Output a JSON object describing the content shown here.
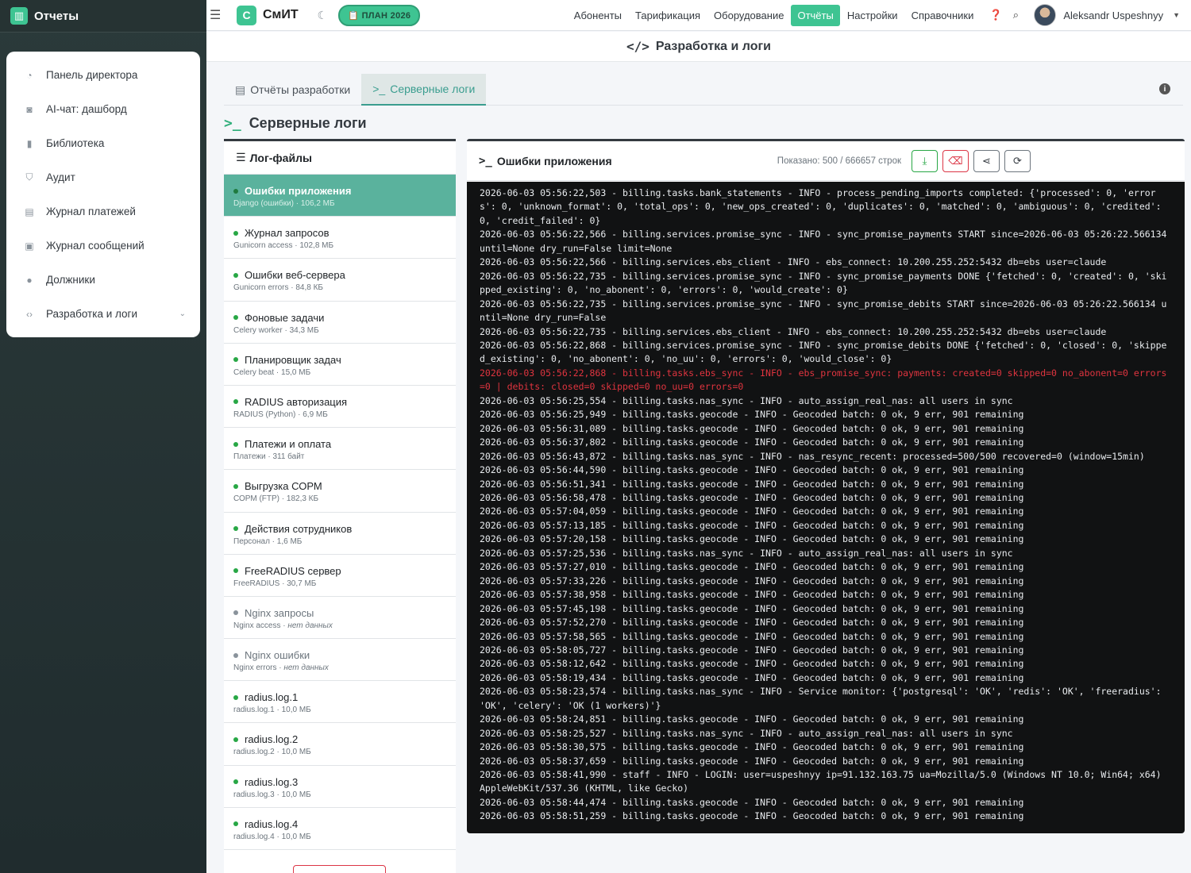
{
  "sidebar": {
    "brand": "Отчеты",
    "items": [
      {
        "label": "Панель директора",
        "icon": "gauge-icon"
      },
      {
        "label": "AI-чат: дашборд",
        "icon": "robot-icon"
      },
      {
        "label": "Библиотека",
        "icon": "book-icon"
      },
      {
        "label": "Аудит",
        "icon": "shield-icon"
      },
      {
        "label": "Журнал платежей",
        "icon": "file-invoice-icon"
      },
      {
        "label": "Журнал сообщений",
        "icon": "message-icon"
      },
      {
        "label": "Должники",
        "icon": "users-icon"
      },
      {
        "label": "Разработка и логи",
        "icon": "code-icon"
      }
    ]
  },
  "topnav": {
    "logo_letter": "С",
    "logo_text": "СмИТ",
    "plan_badge": "📋 ПЛАН 2026",
    "links": [
      "Абоненты",
      "Тарификация",
      "Оборудование",
      "Отчёты",
      "Настройки",
      "Справочники"
    ],
    "active_link": "Отчёты",
    "user": "Aleksandr Uspeshnyy"
  },
  "page": {
    "title": "Разработка и логи",
    "tabs": [
      {
        "label": "Отчёты разработки",
        "active": false
      },
      {
        "label": "Серверные логи",
        "active": true
      }
    ],
    "section_title": "Серверные логи"
  },
  "files": {
    "header": "Лог-файлы",
    "items": [
      {
        "name": "Ошибки приложения",
        "meta": "Django (ошибки) · 106,2 МБ",
        "status": "active"
      },
      {
        "name": "Журнал запросов",
        "meta": "Gunicorn access · 102,8 МБ",
        "status": "ok"
      },
      {
        "name": "Ошибки веб-сервера",
        "meta": "Gunicorn errors · 84,8 КБ",
        "status": "ok"
      },
      {
        "name": "Фоновые задачи",
        "meta": "Celery worker · 34,3 МБ",
        "status": "ok"
      },
      {
        "name": "Планировщик задач",
        "meta": "Celery beat · 15,0 МБ",
        "status": "ok"
      },
      {
        "name": "RADIUS авторизация",
        "meta": "RADIUS (Python) · 6,9 МБ",
        "status": "ok"
      },
      {
        "name": "Платежи и оплата",
        "meta": "Платежи · 311 байт",
        "status": "ok"
      },
      {
        "name": "Выгрузка СОРМ",
        "meta": "СОРМ (FTP) · 182,3 КБ",
        "status": "ok"
      },
      {
        "name": "Действия сотрудников",
        "meta": "Персонал · 1,6 МБ",
        "status": "ok"
      },
      {
        "name": "FreeRADIUS сервер",
        "meta": "FreeRADIUS · 30,7 МБ",
        "status": "ok"
      },
      {
        "name": "Nginx запросы",
        "meta": "Nginx access · ",
        "meta_em": "нет данных",
        "status": "empty"
      },
      {
        "name": "Nginx ошибки",
        "meta": "Nginx errors · ",
        "meta_em": "нет данных",
        "status": "empty"
      },
      {
        "name": "radius.log.1",
        "meta": "radius.log.1 · 10,0 МБ",
        "status": "ok"
      },
      {
        "name": "radius.log.2",
        "meta": "radius.log.2 · 10,0 МБ",
        "status": "ok"
      },
      {
        "name": "radius.log.3",
        "meta": "radius.log.3 · 10,0 МБ",
        "status": "ok"
      },
      {
        "name": "radius.log.4",
        "meta": "radius.log.4 · 10,0 МБ",
        "status": "ok"
      }
    ]
  },
  "log": {
    "title": "Ошибки приложения",
    "shown": "Показано: 500 / 666657 строк",
    "buttons": [
      {
        "name": "download-button",
        "icon": "download-icon",
        "style": "green"
      },
      {
        "name": "clear-log-button",
        "icon": "eraser-icon",
        "style": "red"
      },
      {
        "name": "share-button",
        "icon": "share-icon",
        "style": "dark"
      },
      {
        "name": "refresh-button",
        "icon": "refresh-icon",
        "style": "dark"
      }
    ],
    "lines": [
      {
        "text": "2026-06-03 05:56:22,503 - billing.tasks.bank_statements - INFO - process_pending_imports completed: {'processed': 0, 'errors': 0, 'unknown_format': 0, 'total_ops': 0, 'new_ops_created': 0, 'duplicates': 0, 'matched': 0, 'ambiguous': 0, 'credited': 0, 'credit_failed': 0}",
        "level": "info"
      },
      {
        "text": "2026-06-03 05:56:22,566 - billing.services.promise_sync - INFO - sync_promise_payments START since=2026-06-03 05:26:22.566134 until=None dry_run=False limit=None",
        "level": "info"
      },
      {
        "text": "2026-06-03 05:56:22,566 - billing.services.ebs_client - INFO - ebs_connect: 10.200.255.252:5432 db=ebs user=claude",
        "level": "info"
      },
      {
        "text": "2026-06-03 05:56:22,735 - billing.services.promise_sync - INFO - sync_promise_payments DONE {'fetched': 0, 'created': 0, 'skipped_existing': 0, 'no_abonent': 0, 'errors': 0, 'would_create': 0}",
        "level": "info"
      },
      {
        "text": "2026-06-03 05:56:22,735 - billing.services.promise_sync - INFO - sync_promise_debits START since=2026-06-03 05:26:22.566134 until=None dry_run=False",
        "level": "info"
      },
      {
        "text": "2026-06-03 05:56:22,735 - billing.services.ebs_client - INFO - ebs_connect: 10.200.255.252:5432 db=ebs user=claude",
        "level": "info"
      },
      {
        "text": "2026-06-03 05:56:22,868 - billing.services.promise_sync - INFO - sync_promise_debits DONE {'fetched': 0, 'closed': 0, 'skipped_existing': 0, 'no_abonent': 0, 'no_uu': 0, 'errors': 0, 'would_close': 0}",
        "level": "info"
      },
      {
        "text": "2026-06-03 05:56:22,868 - billing.tasks.ebs_sync - INFO - ebs_promise_sync: payments: created=0 skipped=0 no_abonent=0 errors=0 | debits: closed=0 skipped=0 no_uu=0 errors=0",
        "level": "error"
      },
      {
        "text": "2026-06-03 05:56:25,554 - billing.tasks.nas_sync - INFO - auto_assign_real_nas: all users in sync",
        "level": "info"
      },
      {
        "text": "2026-06-03 05:56:25,949 - billing.tasks.geocode - INFO - Geocoded batch: 0 ok, 9 err, 901 remaining",
        "level": "info"
      },
      {
        "text": "2026-06-03 05:56:31,089 - billing.tasks.geocode - INFO - Geocoded batch: 0 ok, 9 err, 901 remaining",
        "level": "info"
      },
      {
        "text": "2026-06-03 05:56:37,802 - billing.tasks.geocode - INFO - Geocoded batch: 0 ok, 9 err, 901 remaining",
        "level": "info"
      },
      {
        "text": "2026-06-03 05:56:43,872 - billing.tasks.nas_sync - INFO - nas_resync_recent: processed=500/500 recovered=0 (window=15min)",
        "level": "info"
      },
      {
        "text": "2026-06-03 05:56:44,590 - billing.tasks.geocode - INFO - Geocoded batch: 0 ok, 9 err, 901 remaining",
        "level": "info"
      },
      {
        "text": "2026-06-03 05:56:51,341 - billing.tasks.geocode - INFO - Geocoded batch: 0 ok, 9 err, 901 remaining",
        "level": "info"
      },
      {
        "text": "2026-06-03 05:56:58,478 - billing.tasks.geocode - INFO - Geocoded batch: 0 ok, 9 err, 901 remaining",
        "level": "info"
      },
      {
        "text": "2026-06-03 05:57:04,059 - billing.tasks.geocode - INFO - Geocoded batch: 0 ok, 9 err, 901 remaining",
        "level": "info"
      },
      {
        "text": "2026-06-03 05:57:13,185 - billing.tasks.geocode - INFO - Geocoded batch: 0 ok, 9 err, 901 remaining",
        "level": "info"
      },
      {
        "text": "2026-06-03 05:57:20,158 - billing.tasks.geocode - INFO - Geocoded batch: 0 ok, 9 err, 901 remaining",
        "level": "info"
      },
      {
        "text": "2026-06-03 05:57:25,536 - billing.tasks.nas_sync - INFO - auto_assign_real_nas: all users in sync",
        "level": "info"
      },
      {
        "text": "2026-06-03 05:57:27,010 - billing.tasks.geocode - INFO - Geocoded batch: 0 ok, 9 err, 901 remaining",
        "level": "info"
      },
      {
        "text": "2026-06-03 05:57:33,226 - billing.tasks.geocode - INFO - Geocoded batch: 0 ok, 9 err, 901 remaining",
        "level": "info"
      },
      {
        "text": "2026-06-03 05:57:38,958 - billing.tasks.geocode - INFO - Geocoded batch: 0 ok, 9 err, 901 remaining",
        "level": "info"
      },
      {
        "text": "2026-06-03 05:57:45,198 - billing.tasks.geocode - INFO - Geocoded batch: 0 ok, 9 err, 901 remaining",
        "level": "info"
      },
      {
        "text": "2026-06-03 05:57:52,270 - billing.tasks.geocode - INFO - Geocoded batch: 0 ok, 9 err, 901 remaining",
        "level": "info"
      },
      {
        "text": "2026-06-03 05:57:58,565 - billing.tasks.geocode - INFO - Geocoded batch: 0 ok, 9 err, 901 remaining",
        "level": "info"
      },
      {
        "text": "2026-06-03 05:58:05,727 - billing.tasks.geocode - INFO - Geocoded batch: 0 ok, 9 err, 901 remaining",
        "level": "info"
      },
      {
        "text": "2026-06-03 05:58:12,642 - billing.tasks.geocode - INFO - Geocoded batch: 0 ok, 9 err, 901 remaining",
        "level": "info"
      },
      {
        "text": "2026-06-03 05:58:19,434 - billing.tasks.geocode - INFO - Geocoded batch: 0 ok, 9 err, 901 remaining",
        "level": "info"
      },
      {
        "text": "2026-06-03 05:58:23,574 - billing.tasks.nas_sync - INFO - Service monitor: {'postgresql': 'OK', 'redis': 'OK', 'freeradius': 'OK', 'celery': 'OK (1 workers)'}",
        "level": "info"
      },
      {
        "text": "2026-06-03 05:58:24,851 - billing.tasks.geocode - INFO - Geocoded batch: 0 ok, 9 err, 901 remaining",
        "level": "info"
      },
      {
        "text": "2026-06-03 05:58:25,527 - billing.tasks.nas_sync - INFO - auto_assign_real_nas: all users in sync",
        "level": "info"
      },
      {
        "text": "2026-06-03 05:58:30,575 - billing.tasks.geocode - INFO - Geocoded batch: 0 ok, 9 err, 901 remaining",
        "level": "info"
      },
      {
        "text": "2026-06-03 05:58:37,659 - billing.tasks.geocode - INFO - Geocoded batch: 0 ok, 9 err, 901 remaining",
        "level": "info"
      },
      {
        "text": "2026-06-03 05:58:41,990 - staff - INFO - LOGIN: user=uspeshnyy ip=91.132.163.75 ua=Mozilla/5.0 (Windows NT 10.0; Win64; x64) AppleWebKit/537.36 (KHTML, like Gecko)",
        "level": "info"
      },
      {
        "text": "2026-06-03 05:58:44,474 - billing.tasks.geocode - INFO - Geocoded batch: 0 ok, 9 err, 901 remaining",
        "level": "info"
      },
      {
        "text": "2026-06-03 05:58:51,259 - billing.tasks.geocode - INFO - Geocoded batch: 0 ok, 9 err, 901 remaining",
        "level": "info"
      }
    ]
  },
  "colors": {
    "accent": "#3ec492",
    "tab_active": "#3a9d8f",
    "file_active": "#5ab29d",
    "error": "#e0343f"
  }
}
